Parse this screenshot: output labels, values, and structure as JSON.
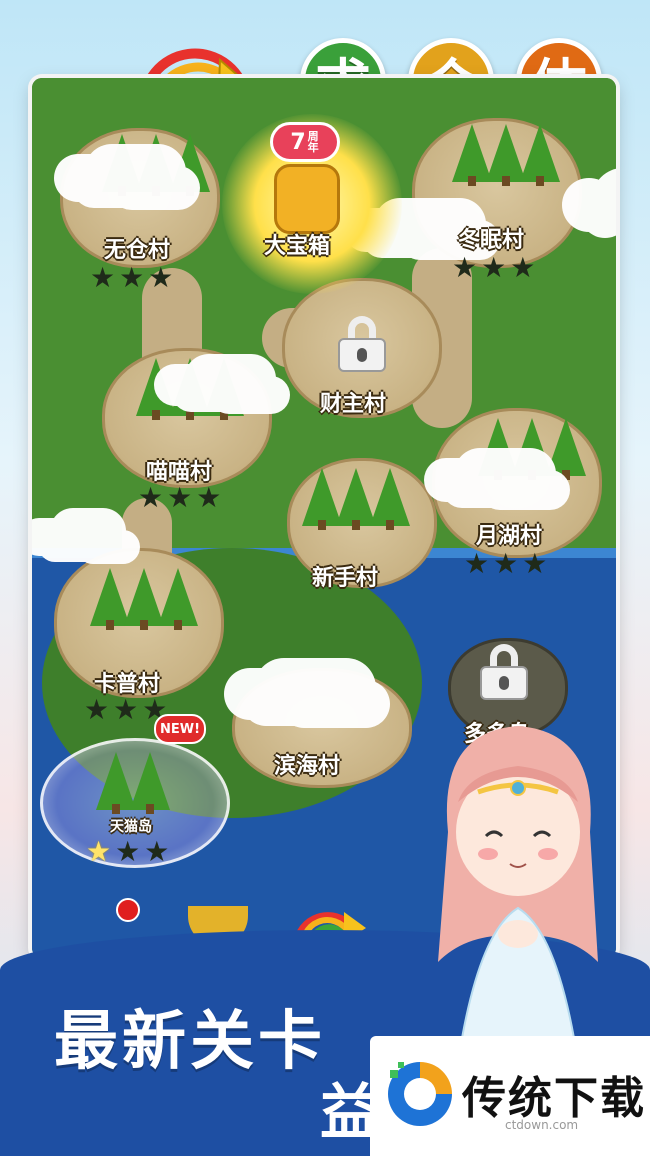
{
  "title_badges": [
    {
      "char": "求",
      "color": "#3aa03a"
    },
    {
      "char": "合",
      "color": "#e2a21c"
    },
    {
      "char": "体",
      "color": "#e06a14"
    }
  ],
  "event": {
    "tag_number": "7",
    "tag_unit": "周年",
    "label": "大宝箱"
  },
  "villages": [
    {
      "name": "无仓村",
      "stars_earned": 0,
      "stars_total": 3
    },
    {
      "name": "冬眠村",
      "stars_earned": 0,
      "stars_total": 3
    },
    {
      "name": "财主村",
      "locked": true
    },
    {
      "name": "喵喵村",
      "stars_earned": 0,
      "stars_total": 3
    },
    {
      "name": "月湖村",
      "stars_earned": 0,
      "stars_total": 3
    },
    {
      "name": "新手村"
    },
    {
      "name": "卡普村",
      "stars_earned": 0,
      "stars_total": 3
    },
    {
      "name": "滨海村"
    },
    {
      "name": "多多岛",
      "locked": true
    },
    {
      "name": "天猫岛",
      "badge": "NEW!",
      "stars_earned": 1,
      "stars_total": 3
    }
  ],
  "slogan": {
    "line1": "最新关卡",
    "line2": "益"
  },
  "watermark": {
    "brand": "传统下载",
    "url": "ctdown.com"
  },
  "colors": {
    "sea": "#1f57a6",
    "land": "#4a8f32",
    "banner": "#1e4fa3",
    "new_tag": "#e02b2b"
  },
  "icons": [
    "rainbow-arrow-icon",
    "lock-icon",
    "star-icon",
    "trophy-icon",
    "notification-dot-icon"
  ]
}
